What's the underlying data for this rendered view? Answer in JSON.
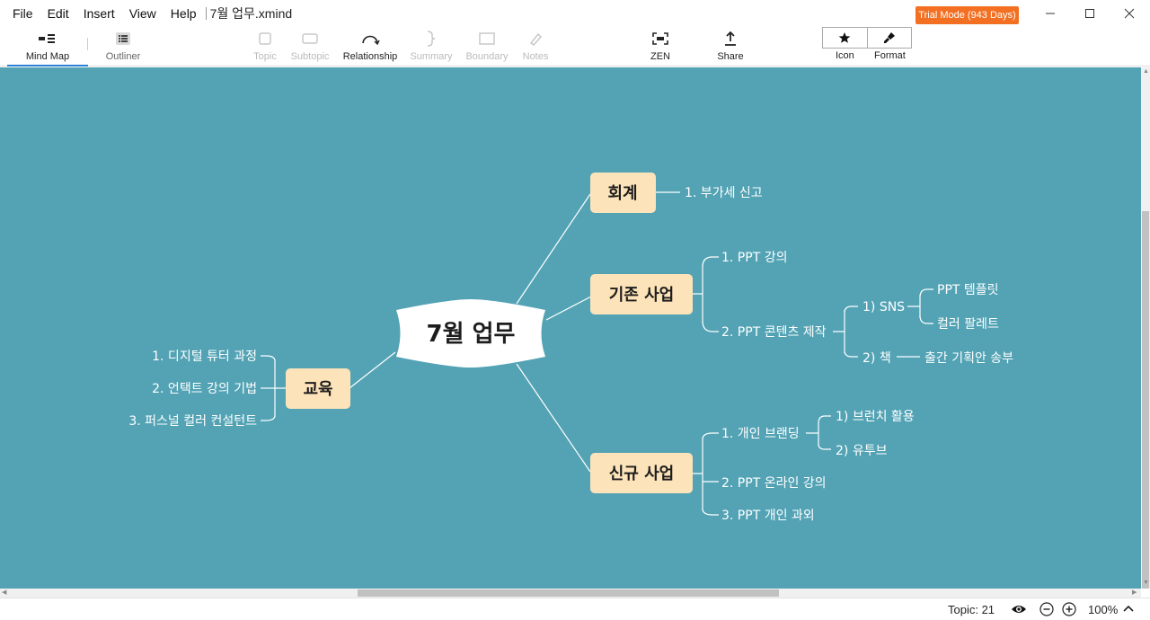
{
  "menu": {
    "file": "File",
    "edit": "Edit",
    "insert": "Insert",
    "view": "View",
    "help": "Help"
  },
  "window": {
    "title": "7월 업무.xmind",
    "trial": "Trial Mode (943 Days)"
  },
  "toolbar": {
    "mind_map": "Mind Map",
    "outliner": "Outliner",
    "topic": "Topic",
    "subtopic": "Subtopic",
    "relationship": "Relationship",
    "summary": "Summary",
    "boundary": "Boundary",
    "notes": "Notes",
    "zen": "ZEN",
    "share": "Share",
    "icon": "Icon",
    "format": "Format"
  },
  "mindmap": {
    "central": "7월 업무",
    "accounting": {
      "title": "회계",
      "items": [
        "1. 부가세 신고"
      ]
    },
    "existing": {
      "title": "기존 사업",
      "item1": "1. PPT 강의",
      "item2": "2. PPT 콘텐츠 제작",
      "sns": "1) SNS",
      "sns_template": "PPT 템플릿",
      "sns_palette": "컬러 팔레트",
      "book": "2) 책",
      "book_proposal": "출간 기획안 송부"
    },
    "new_business": {
      "title": "신규 사업",
      "item1": "1. 개인 브랜딩",
      "brunch": "1) 브런치 활용",
      "youtube": "2) 유투브",
      "item2": "2. PPT 온라인 강의",
      "item3": "3. PPT 개인 과외"
    },
    "education": {
      "title": "교육",
      "items": [
        "1. 디지털 튜터 과정",
        "2. 언택트 강의 기법",
        "3. 퍼스널 컬러 컨설턴트"
      ]
    }
  },
  "colors": {
    "canvas": "#53a3b5",
    "topic_fill": "#fde3b9",
    "trial": "#f36f21"
  },
  "status": {
    "topic_count": "Topic: 21",
    "zoom": "100%"
  }
}
